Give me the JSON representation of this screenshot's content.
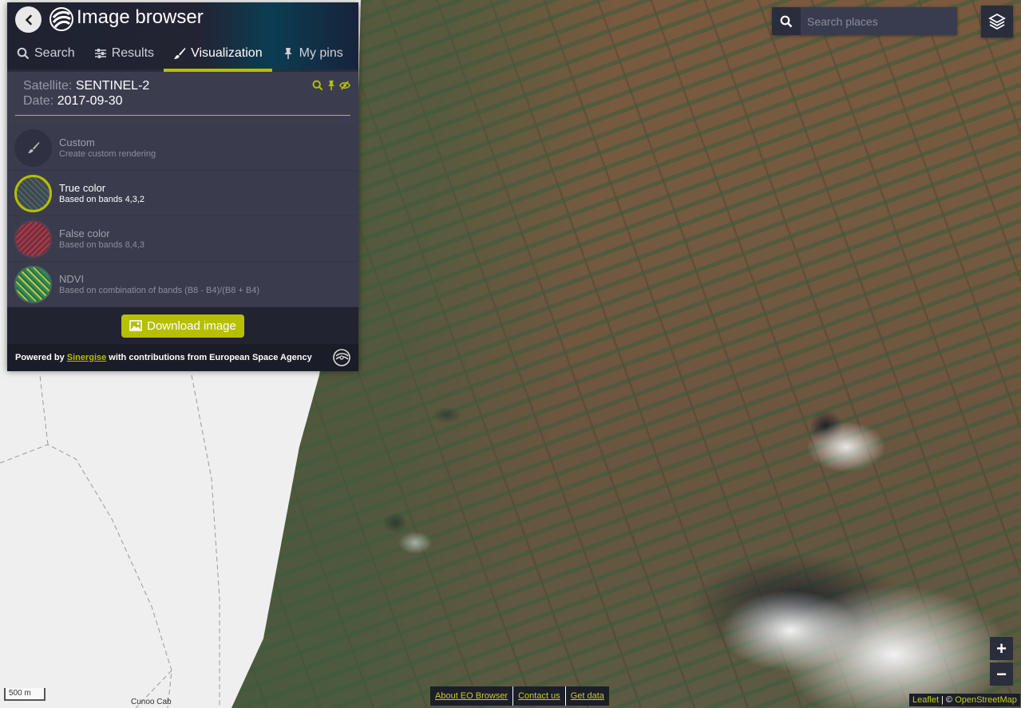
{
  "app": {
    "title": "Image browser"
  },
  "tabs": [
    {
      "label": "Search",
      "icon": "search-icon"
    },
    {
      "label": "Results",
      "icon": "sliders-icon"
    },
    {
      "label": "Visualization",
      "icon": "brush-icon",
      "active": true
    },
    {
      "label": "My pins",
      "icon": "pin-icon"
    }
  ],
  "scene": {
    "satellite_label": "Satellite:",
    "satellite_value": "SENTINEL-2",
    "date_label": "Date:",
    "date_value": "2017-09-30"
  },
  "layers": [
    {
      "title": "Custom",
      "desc": "Create custom rendering"
    },
    {
      "title": "True color",
      "desc": "Based on bands 4,3,2",
      "active": true
    },
    {
      "title": "False color",
      "desc": "Based on bands 8,4,3"
    },
    {
      "title": "NDVI",
      "desc": "Based on combination of bands (B8 - B4)/(B8 + B4)"
    }
  ],
  "download": {
    "label": "Download image"
  },
  "footer": {
    "prefix": "Powered by",
    "link": "Sinergise",
    "suffix": "with contributions from European Space Agency"
  },
  "search": {
    "placeholder": "Search places"
  },
  "zoom": {
    "in": "+",
    "out": "−"
  },
  "map": {
    "scale": "500 m",
    "place_label": "Cunoo Cab"
  },
  "bottom_links": [
    "About EO Browser",
    "Contact us",
    "Get data"
  ],
  "attribution": {
    "leaflet": "Leaflet",
    "sep": "| ©",
    "osm": "OpenStreetMap"
  },
  "colors": {
    "accent": "#b6bf00",
    "panel": "#3b3d4f",
    "dark": "#212331"
  }
}
